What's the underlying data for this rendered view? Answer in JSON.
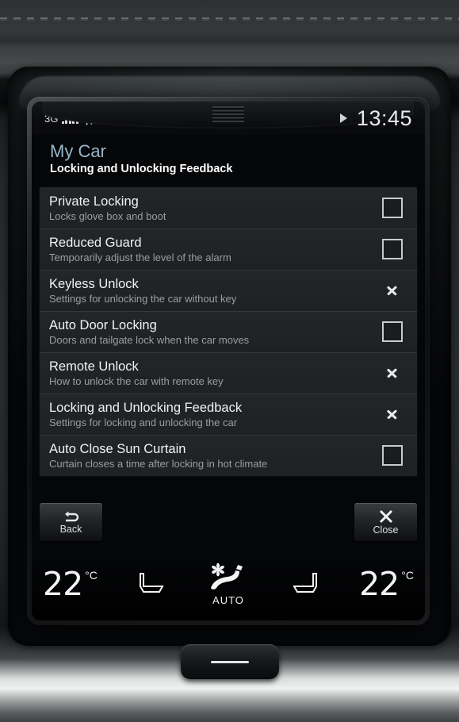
{
  "status_bar": {
    "network": "3G",
    "signal_bars": 5,
    "bluetooth_icon": "bluetooth-icon",
    "media_play_icon": "play-icon",
    "time": "13:45"
  },
  "header": {
    "title": "My Car",
    "subtitle": "Locking and Unlocking Feedback",
    "title_color": "#9ab6c9"
  },
  "list": {
    "items": [
      {
        "title": "Private Locking",
        "subtitle": "Locks glove box and boot",
        "control": "checkbox",
        "checked": false
      },
      {
        "title": "Reduced Guard",
        "subtitle": "Temporarily adjust the level of the alarm",
        "control": "checkbox",
        "checked": false
      },
      {
        "title": "Keyless Unlock",
        "subtitle": "Settings for unlocking the car without key",
        "control": "chevron"
      },
      {
        "title": "Auto Door Locking",
        "subtitle": "Doors and tailgate lock when the car moves",
        "control": "checkbox",
        "checked": false
      },
      {
        "title": "Remote Unlock",
        "subtitle": "How to unlock the car with remote key",
        "control": "chevron"
      },
      {
        "title": "Locking and Unlocking Feedback",
        "subtitle": "Settings for locking and unlocking the car",
        "control": "chevron"
      },
      {
        "title": "Auto Close Sun Curtain",
        "subtitle": "Curtain closes a time after locking in hot climate",
        "control": "checkbox",
        "checked": false
      }
    ]
  },
  "buttons": {
    "back_label": "Back",
    "back_icon": "back-arrow-icon",
    "close_label": "Close",
    "close_icon": "close-x-icon"
  },
  "climate": {
    "left_temp": "22",
    "left_unit": "°C",
    "right_temp": "22",
    "right_unit": "°C",
    "left_seat_icon": "seat-icon",
    "right_seat_icon": "seat-icon",
    "auto_icon": "auto-climate-seat-airflow-icon",
    "auto_label": "AUTO"
  },
  "hardware": {
    "home_button_icon": "home-bar-icon"
  }
}
